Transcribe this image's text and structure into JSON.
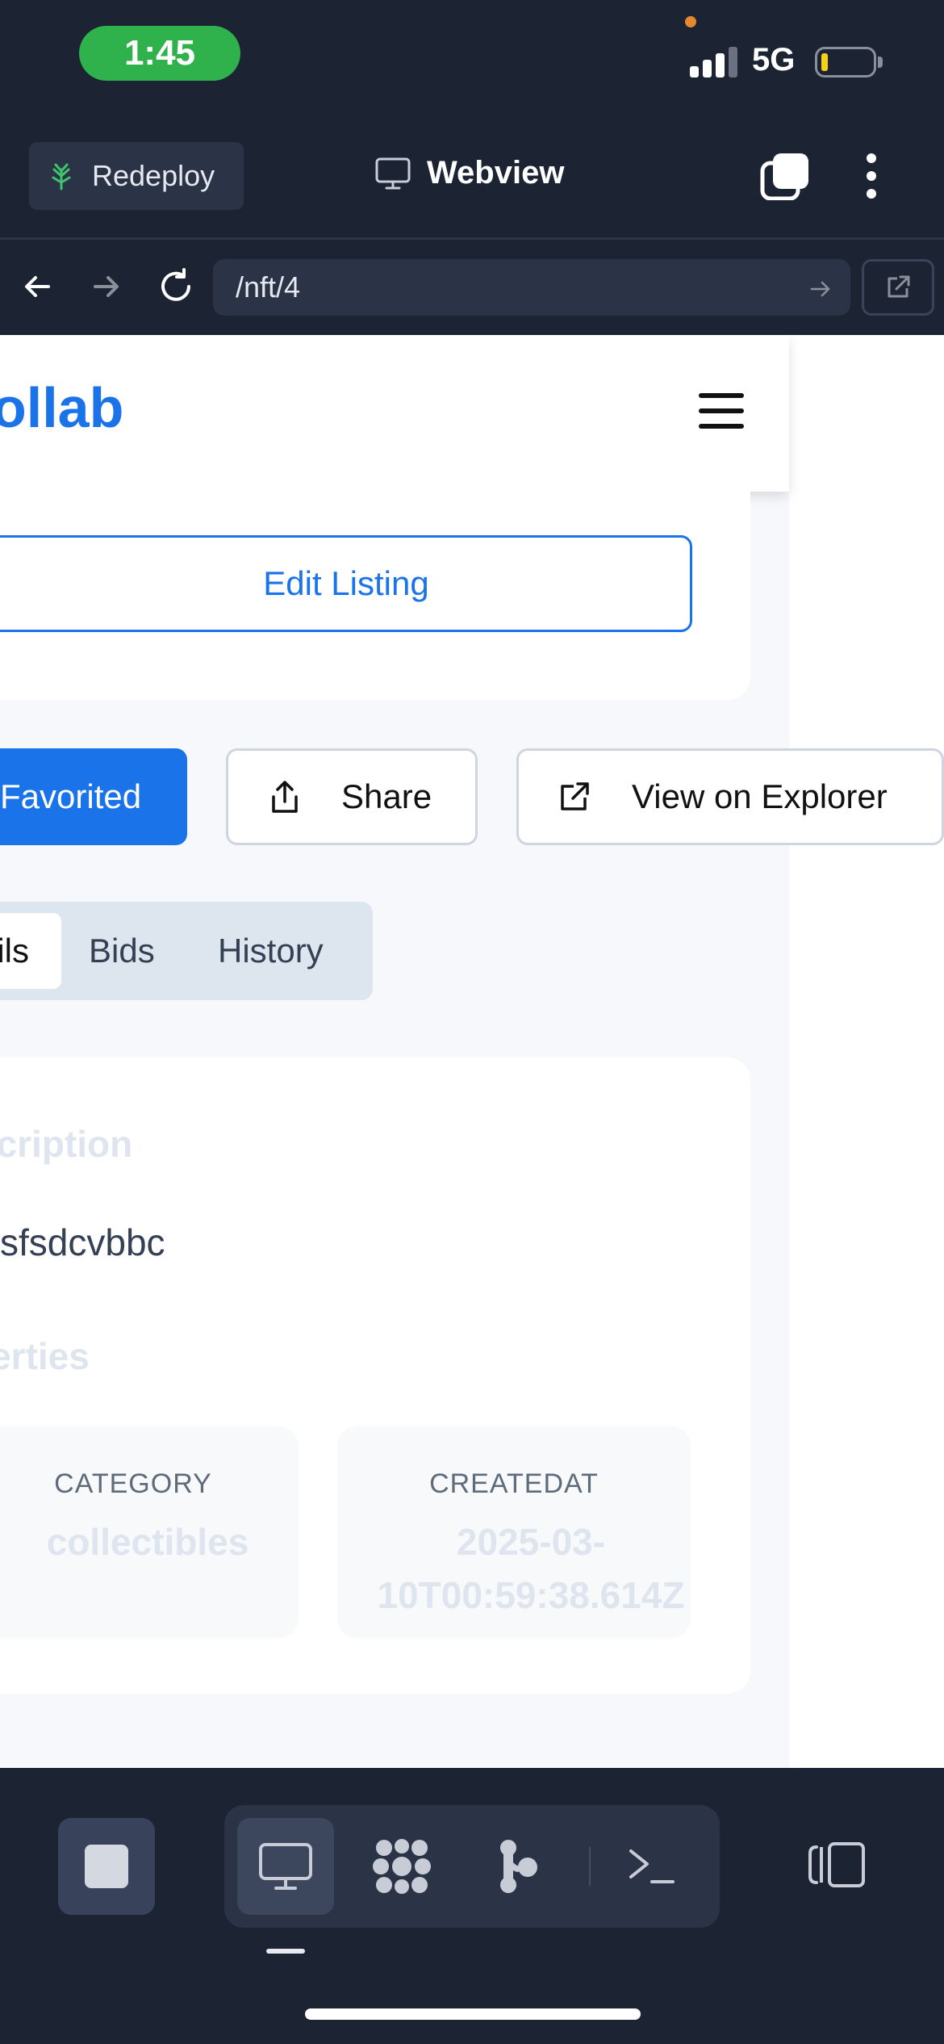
{
  "status_bar": {
    "time": "1:45",
    "network": "5G"
  },
  "toolbar": {
    "redeploy_label": "Redeploy",
    "title": "Webview",
    "icons": [
      "sprout-icon",
      "monitor-icon",
      "tabs-icon",
      "more-vertical-icon"
    ]
  },
  "browser": {
    "url": "/nft/4",
    "icons": [
      "arrow-left-icon",
      "arrow-right-icon",
      "reload-icon",
      "arrow-right-icon",
      "external-link-icon"
    ]
  },
  "page": {
    "brand": "ollab",
    "edit_listing_label": "Edit Listing",
    "actions": {
      "favorited": "Favorited",
      "share": "Share",
      "explorer": "View on Explorer"
    },
    "tabs": {
      "details": "ils",
      "bids": "Bids",
      "history": "History"
    },
    "description_title": "scription",
    "description_text": "sfsdcvbbc",
    "properties_title": "perties",
    "properties": [
      {
        "label": "CATEGORY",
        "value": "collectibles"
      },
      {
        "label": "CREATEDAT",
        "value": "2025-03-10T00:59:38.614Z"
      }
    ]
  },
  "bottom_bar": {
    "icons": [
      "stop-icon",
      "monitor-icon",
      "packages-icon",
      "git-icon",
      "terminal-icon",
      "panel-toggle-icon"
    ]
  },
  "colors": {
    "app_bg": "#1c2333",
    "accent": "#1a73e8",
    "time_pill": "#2fb24c"
  }
}
